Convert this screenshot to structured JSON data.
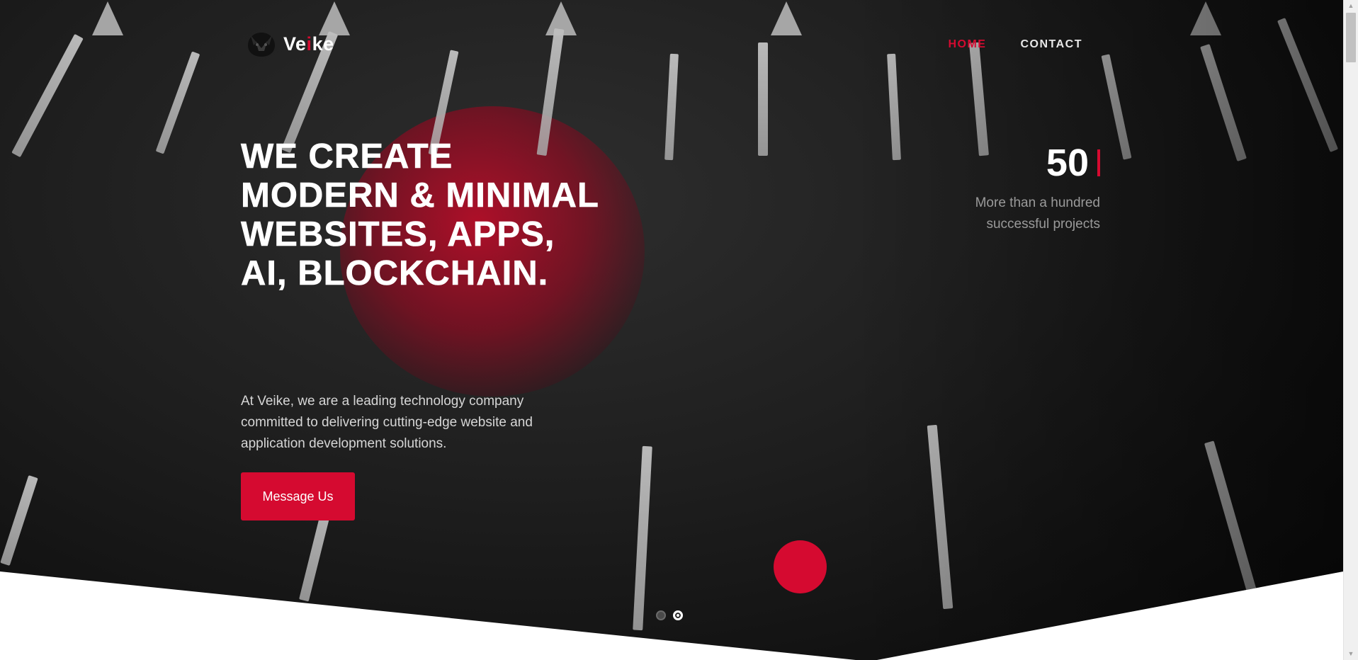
{
  "header": {
    "logo": {
      "text_before": "Ve",
      "text_accent": "i",
      "text_after": "ke"
    },
    "nav": [
      {
        "label": "HOME",
        "active": true
      },
      {
        "label": "CONTACT",
        "active": false
      }
    ]
  },
  "hero": {
    "headline": "WE CREATE MODERN & MINIMAL WEBSITES, APPS, AI, BLOCKCHAIN.",
    "description": "At Veike, we are a leading technology company committed to delivering cutting-edge website and application development solutions.",
    "cta_label": "Message Us",
    "stat": {
      "number": "50",
      "caption": "More than a hundred successful projects"
    },
    "slider": {
      "count": 2,
      "active_index": 1
    }
  },
  "colors": {
    "accent": "#d50a30",
    "hero_background": "#1a1a1a",
    "text_light": "#ffffff",
    "text_muted": "#9a9a9a"
  },
  "icons": {
    "logo": "veike-logo-icon",
    "scroll": "scroll-down-dot",
    "scroll_up": "scrollbar-up-arrow-icon",
    "scroll_down": "scrollbar-down-arrow-icon"
  }
}
